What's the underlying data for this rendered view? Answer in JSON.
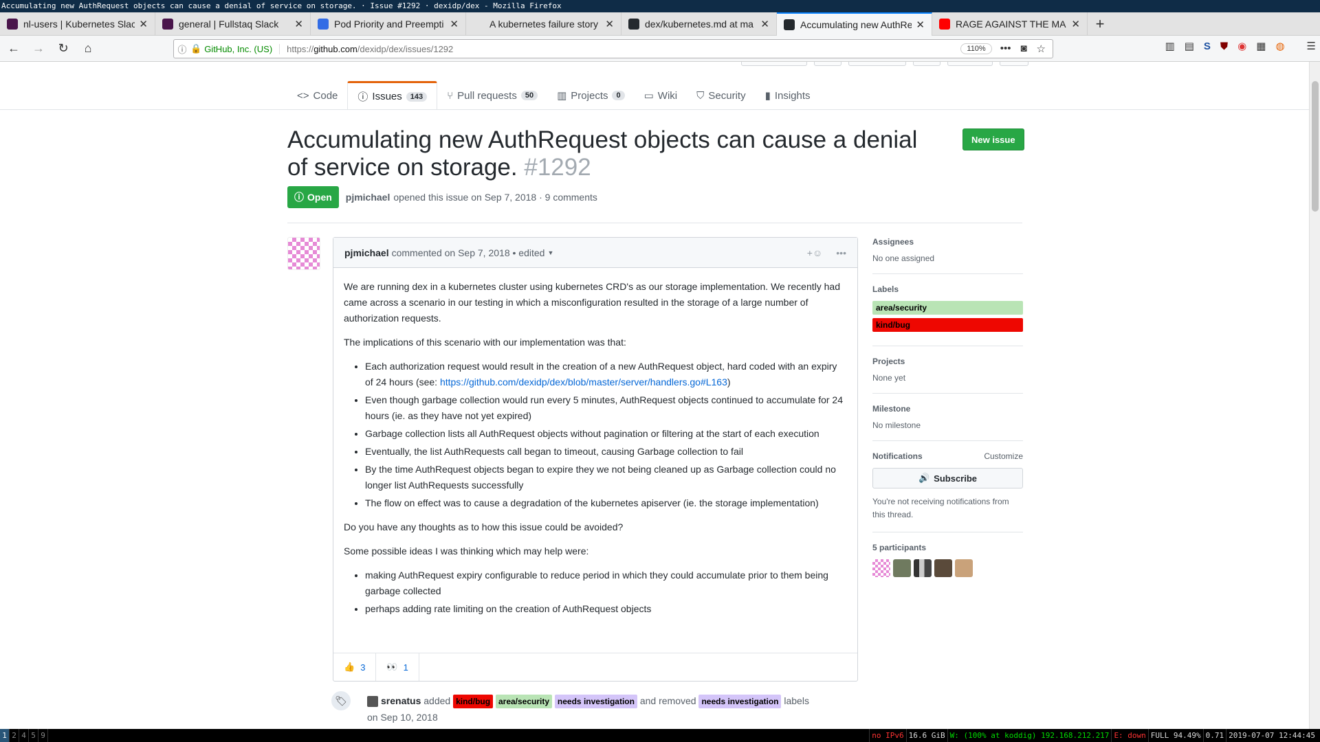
{
  "window_title": "Accumulating new AuthRequest objects can cause a denial of service on storage. · Issue #1292 · dexidp/dex - Mozilla Firefox",
  "tabs": [
    {
      "title": "nl-users | Kubernetes Slac",
      "icon": "slack-icon",
      "color": "#4a154b"
    },
    {
      "title": "general | Fullstaq Slack",
      "icon": "slack-icon",
      "color": "#4a154b"
    },
    {
      "title": "Pod Priority and Preempti",
      "icon": "kubernetes-icon",
      "color": "#326ce5"
    },
    {
      "title": "A kubernetes failure story (#",
      "icon": "blank-icon",
      "color": "#e3e3e3"
    },
    {
      "title": "dex/kubernetes.md at ma",
      "icon": "github-icon",
      "color": "#24292e"
    },
    {
      "title": "Accumulating new AuthRe",
      "icon": "github-icon",
      "color": "#24292e"
    },
    {
      "title": "RAGE AGAINST THE MA",
      "icon": "youtube-icon",
      "color": "#ff0000"
    }
  ],
  "active_tab_index": 5,
  "urlbar": {
    "identity": "GitHub, Inc. (US)",
    "url_prefix": "https://",
    "url_host": "github.com",
    "url_path": "/dexidp/dex/issues/1292",
    "zoom": "110%"
  },
  "reponav": {
    "code": "Code",
    "issues": "Issues",
    "issues_count": "143",
    "pulls": "Pull requests",
    "pulls_count": "50",
    "projects": "Projects",
    "projects_count": "0",
    "wiki": "Wiki",
    "security": "Security",
    "insights": "Insights"
  },
  "issue": {
    "title": "Accumulating new AuthRequest objects can cause a denial of service on storage.",
    "number": "#1292",
    "state": "Open",
    "author": "pjmichael",
    "opened_text": "opened this issue on Sep 7, 2018 · 9 comments",
    "new_issue_label": "New issue"
  },
  "comment": {
    "author": "pjmichael",
    "meta": "commented on Sep 7, 2018 • edited",
    "p1": "We are running dex in a kubernetes cluster using kubernetes CRD's as our storage implementation. We recently had came across a scenario in our testing in which a misconfiguration resulted in the storage of a large number of authorization requests.",
    "p2": "The implications of this scenario with our implementation was that:",
    "list1": [
      {
        "text": "Each authorization request would result in the creation of a new AuthRequest object, hard coded with an expiry of 24 hours (see: ",
        "link": "https://github.com/dexidp/dex/blob/master/server/handlers.go#L163",
        "after": ")"
      },
      {
        "text": "Even though garbage collection would run every 5 minutes, AuthRequest objects continued to accumulate for 24 hours (ie. as they have not yet expired)"
      },
      {
        "text": "Garbage collection lists all AuthRequest objects without pagination or filtering at the start of each execution"
      },
      {
        "text": "Eventually, the list AuthRequests call began to timeout, causing Garbage collection to fail"
      },
      {
        "text": "By the time AuthRequest objects began to expire they we not being cleaned up as Garbage collection could no longer list AuthRequests successfully"
      },
      {
        "text": "The flow on effect was to cause a degradation of the kubernetes apiserver (ie. the storage implementation)"
      }
    ],
    "p3": "Do you have any thoughts as to how this issue could be avoided?",
    "p4": "Some possible ideas I was thinking which may help were:",
    "list2": [
      "making AuthRequest expiry configurable to reduce period in which they could accumulate prior to them being garbage collected",
      "perhaps adding rate limiting on the creation of AuthRequest objects"
    ],
    "reactions": [
      {
        "emoji": "👍",
        "count": "3"
      },
      {
        "emoji": "👀",
        "count": "1"
      }
    ]
  },
  "sidebar": {
    "assignees_h": "Assignees",
    "assignees_v": "No one assigned",
    "labels_h": "Labels",
    "labels": [
      {
        "name": "area/security",
        "color": "#b9e4b5"
      },
      {
        "name": "kind/bug",
        "color": "#ee0701"
      }
    ],
    "projects_h": "Projects",
    "projects_v": "None yet",
    "milestone_h": "Milestone",
    "milestone_v": "No milestone",
    "notifications_h": "Notifications",
    "customize": "Customize",
    "subscribe": "Subscribe",
    "notif_text": "You're not receiving notifications from this thread.",
    "participants_h": "5 participants"
  },
  "timeline_event": {
    "author": "srenatus",
    "added": "added",
    "labels_added": [
      {
        "name": "kind/bug",
        "color": "#ee0701"
      },
      {
        "name": "area/security",
        "color": "#b9e4b5"
      },
      {
        "name": "needs investigation",
        "color": "#d4c5f9"
      }
    ],
    "removed_text": "and removed",
    "label_removed": {
      "name": "needs investigation",
      "color": "#d4c5f9"
    },
    "labels_word": "labels",
    "date": "on Sep 10, 2018"
  },
  "statusbar": {
    "workspaces": [
      "1",
      "2",
      "4",
      "5",
      "9"
    ],
    "active_workspace": "1",
    "items": [
      "no IPv6",
      "16.6 GiB",
      "W: (100% at koddig) 192.168.212.217",
      "E: down",
      "FULL 94.49%",
      "0.71",
      "2019-07-07 12:44:45"
    ]
  }
}
